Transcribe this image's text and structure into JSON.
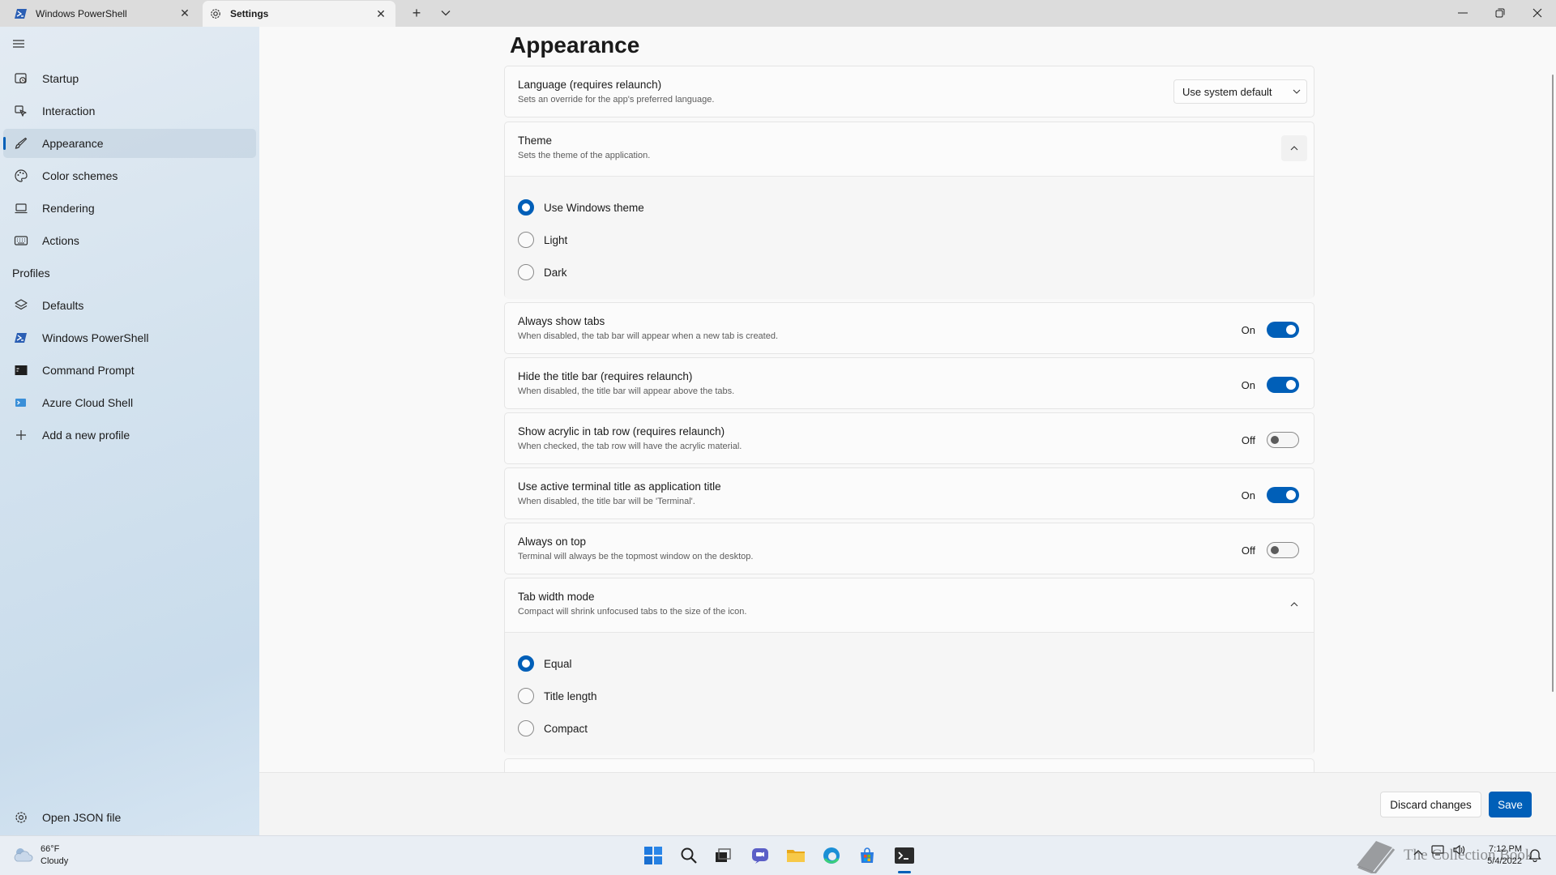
{
  "tabs": [
    {
      "title": "Windows PowerShell"
    },
    {
      "title": "Settings"
    }
  ],
  "sidebar": {
    "items": [
      {
        "label": "Startup"
      },
      {
        "label": "Interaction"
      },
      {
        "label": "Appearance"
      },
      {
        "label": "Color schemes"
      },
      {
        "label": "Rendering"
      },
      {
        "label": "Actions"
      }
    ],
    "profiles_header": "Profiles",
    "profiles": [
      {
        "label": "Defaults"
      },
      {
        "label": "Windows PowerShell"
      },
      {
        "label": "Command Prompt"
      },
      {
        "label": "Azure Cloud Shell"
      },
      {
        "label": "Add a new profile"
      }
    ],
    "open_json": "Open JSON file"
  },
  "page": {
    "title": "Appearance",
    "language": {
      "title": "Language (requires relaunch)",
      "desc": "Sets an override for the app's preferred language.",
      "value": "Use system default"
    },
    "theme": {
      "title": "Theme",
      "desc": "Sets the theme of the application.",
      "options": [
        "Use Windows theme",
        "Light",
        "Dark"
      ],
      "selected": "Use Windows theme"
    },
    "toggles": [
      {
        "title": "Always show tabs",
        "desc": "When disabled, the tab bar will appear when a new tab is created.",
        "state": "On"
      },
      {
        "title": "Hide the title bar (requires relaunch)",
        "desc": "When disabled, the title bar will appear above the tabs.",
        "state": "On"
      },
      {
        "title": "Show acrylic in tab row (requires relaunch)",
        "desc": "When checked, the tab row will have the acrylic material.",
        "state": "Off"
      },
      {
        "title": "Use active terminal title as application title",
        "desc": "When disabled, the title bar will be 'Terminal'.",
        "state": "On"
      },
      {
        "title": "Always on top",
        "desc": "Terminal will always be the topmost window on the desktop.",
        "state": "Off"
      }
    ],
    "tab_width": {
      "title": "Tab width mode",
      "desc": "Compact will shrink unfocused tabs to the size of the icon.",
      "options": [
        "Equal",
        "Title length",
        "Compact"
      ],
      "selected": "Equal"
    }
  },
  "footer": {
    "discard": "Discard changes",
    "save": "Save"
  },
  "taskbar": {
    "temp": "66°F",
    "condition": "Cloudy",
    "time": "7:12 PM",
    "date": "5/4/2022",
    "watermark": "The Collection Book"
  },
  "colors": {
    "accent": "#005fb8"
  }
}
